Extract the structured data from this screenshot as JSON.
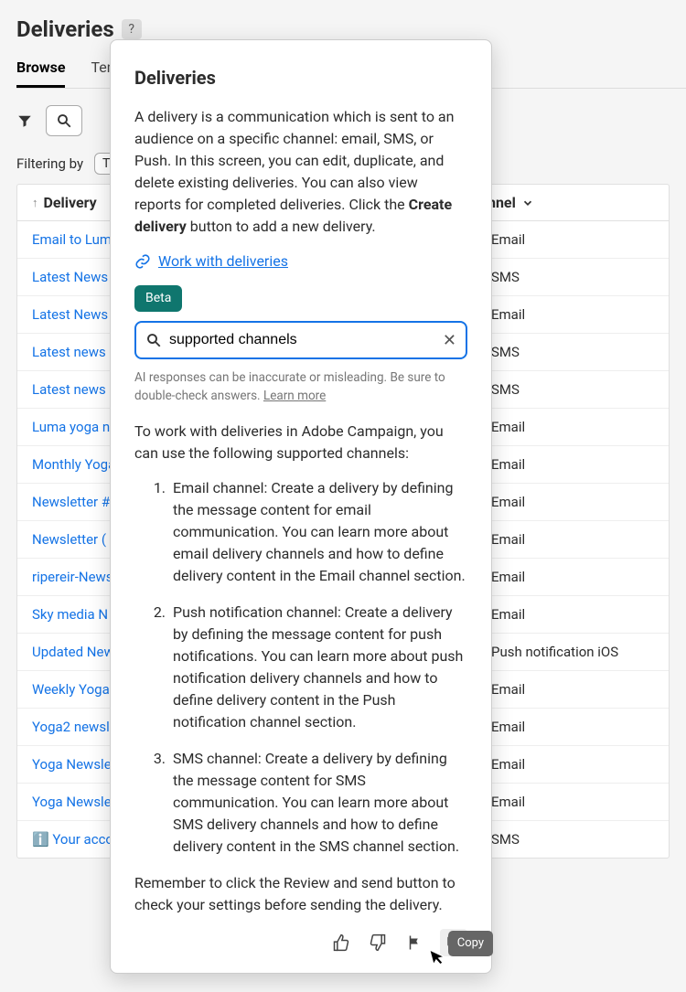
{
  "page": {
    "title": "Deliveries"
  },
  "tabs": [
    "Browse",
    "Templates"
  ],
  "filter": {
    "label": "Filtering by",
    "chip": "T"
  },
  "table": {
    "columns": {
      "delivery": "Delivery",
      "channel": "Channel"
    },
    "rows": [
      {
        "name": "Email to Luma",
        "channel": "Email",
        "icon": "email"
      },
      {
        "name": "Latest News",
        "channel": "SMS",
        "icon": "sms"
      },
      {
        "name": "Latest News",
        "channel": "Email",
        "icon": "email"
      },
      {
        "name": "Latest news",
        "channel": "SMS",
        "icon": "sms"
      },
      {
        "name": "Latest news",
        "channel": "SMS",
        "icon": "sms"
      },
      {
        "name": "Luma yoga n",
        "channel": "Email",
        "icon": "email"
      },
      {
        "name": "Monthly Yoga",
        "channel": "Email",
        "icon": "email"
      },
      {
        "name": "Newsletter #",
        "channel": "Email",
        "icon": "email"
      },
      {
        "name": "Newsletter (",
        "channel": "Email",
        "icon": "email"
      },
      {
        "name": "ripereir-News",
        "channel": "Email",
        "icon": "email"
      },
      {
        "name": "Sky media N",
        "channel": "Email",
        "icon": "email"
      },
      {
        "name": "Updated New",
        "channel": "Push notification iOS",
        "icon": "push"
      },
      {
        "name": "Weekly Yoga",
        "channel": "Email",
        "icon": "email"
      },
      {
        "name": "Yoga2 newsl",
        "channel": "Email",
        "icon": "email"
      },
      {
        "name": "Yoga Newsle",
        "channel": "Email",
        "icon": "email"
      },
      {
        "name": "Yoga Newsle",
        "channel": "Email",
        "icon": "email"
      },
      {
        "name": "ℹ️ Your acco",
        "channel": "SMS",
        "icon": "sms"
      }
    ]
  },
  "popover": {
    "title": "Deliveries",
    "desc_pre": "A delivery is a communication which is sent to an audience on a specific channel: email, SMS, or Push. In this screen, you can edit, duplicate, and delete existing deliveries. You can also view reports for completed deliveries. Click the ",
    "desc_bold": "Create delivery",
    "desc_post": " button to add a new delivery.",
    "link": "Work with deliveries",
    "badge": "Beta",
    "search_value": "supported channels",
    "disclaimer": "AI responses can be inaccurate or misleading. Be sure to double-check answers. ",
    "disclaimer_link": "Learn more",
    "answer_intro": "To work with deliveries in Adobe Campaign, you can use the following supported channels:",
    "answer_items": [
      "Email channel: Create a delivery by defining the message content for email communication. You can learn more about email delivery channels and how to define delivery content in the Email channel section.",
      "Push notification channel: Create a delivery by defining the message content for push notifications. You can learn more about push notification delivery channels and how to define delivery content in the Push notification channel section.",
      "SMS channel: Create a delivery by defining the message content for SMS communication. You can learn more about SMS delivery channels and how to define delivery content in the SMS channel section."
    ],
    "answer_footer": "Remember to click the Review and send button to check your settings before sending the delivery.",
    "tooltip": "Copy"
  }
}
